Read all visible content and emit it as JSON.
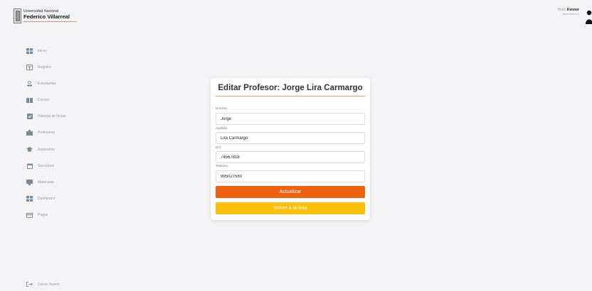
{
  "brand": {
    "line1": "Universidad Nacional",
    "line2": "Federico Villarreal"
  },
  "user": {
    "greeting": "Hola,",
    "name": "Kenner",
    "role": "Administrador"
  },
  "sidebar": {
    "items": [
      {
        "label": "Inicio",
        "icon": "grid-icon"
      },
      {
        "label": "Registro",
        "icon": "register-icon"
      },
      {
        "label": "Estudiantes",
        "icon": "student-icon"
      },
      {
        "label": "Cursos",
        "icon": "book-icon"
      },
      {
        "label": "Historial de Notas",
        "icon": "grades-icon"
      },
      {
        "label": "Profesores",
        "icon": "building-icon"
      },
      {
        "label": "Semestres",
        "icon": "graduation-cap-icon"
      },
      {
        "label": "Secciones",
        "icon": "calendar-icon"
      },
      {
        "label": "Matriculas",
        "icon": "enrollment-icon"
      },
      {
        "label": "Dashboard",
        "icon": "dashboard-icon"
      },
      {
        "label": "Pagos",
        "icon": "card-icon"
      }
    ],
    "logout": "Cerrar Sesión"
  },
  "form": {
    "title": "Editar Profesor: Jorge Lira Carmargo",
    "nombre_label": "Nombre:",
    "nombre_value": "Jorge",
    "apellido_label": "Apellido:",
    "apellido_value": "Lira Carmargo",
    "dni_label": "Dni:",
    "dni_value": "74567818",
    "telefono_label": "Telefono:",
    "telefono_value": "995027580",
    "update_label": "Actualizar",
    "back_label": "Volver a la lista"
  },
  "colors": {
    "accent": "#f0610f",
    "secondary": "#fbbf09",
    "rule": "#f29c6b"
  }
}
